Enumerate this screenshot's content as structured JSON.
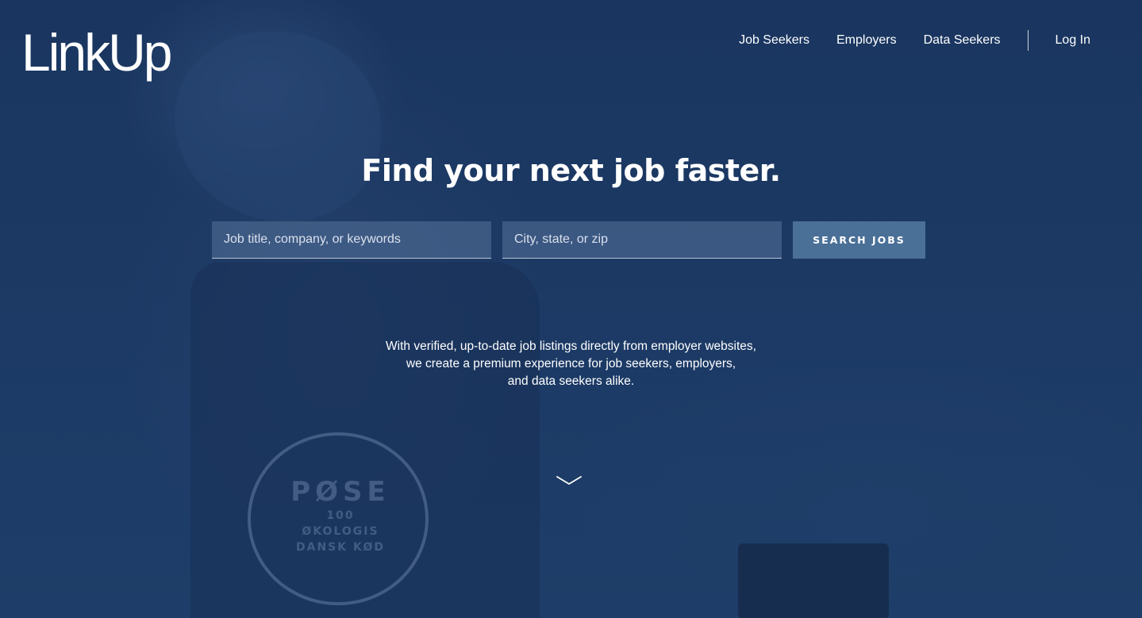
{
  "header": {
    "logo_text": "LinkUp",
    "nav": [
      {
        "label": "Job Seekers"
      },
      {
        "label": "Employers"
      },
      {
        "label": "Data Seekers"
      }
    ],
    "login_label": "Log In"
  },
  "hero": {
    "headline": "Find your next job faster.",
    "search": {
      "what_placeholder": "Job title, company, or keywords",
      "where_placeholder": "City, state, or zip",
      "button_label": "SEARCH JOBS"
    },
    "tagline_lines": [
      "With verified, up-to-date job listings directly from employer websites,",
      "we create a premium experience for job seekers, employers,",
      "and data seekers alike."
    ],
    "scroll_icon": "chevron-down-icon",
    "background_stamp": {
      "line1": "PØSE",
      "line2": "100",
      "line3": "ØKOLOGIS",
      "line4": "DANSK KØD"
    }
  },
  "colors": {
    "background": "#1b3a64",
    "button": "#4b7098",
    "text": "#ffffff"
  }
}
